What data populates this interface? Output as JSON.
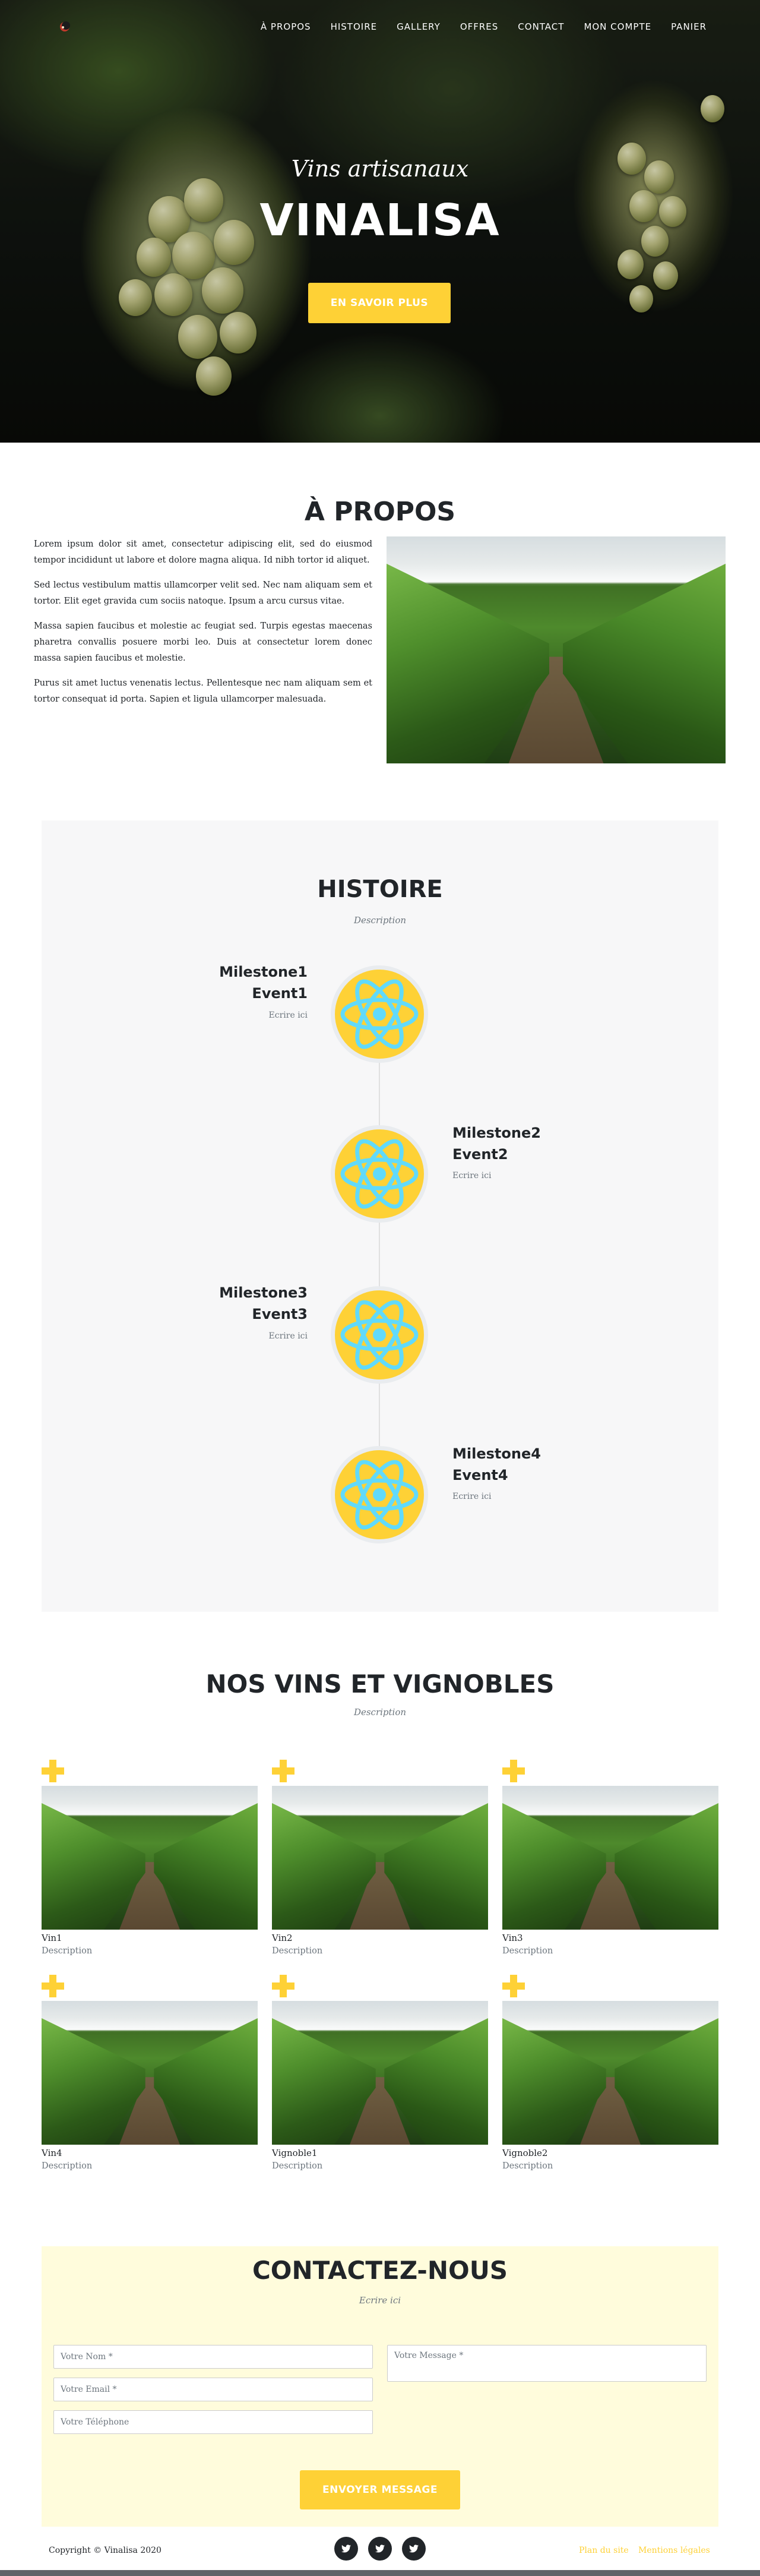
{
  "nav": {
    "items": [
      "À PROPOS",
      "HISTOIRE",
      "GALLERY",
      "OFFRES",
      "CONTACT",
      "MON COMPTE",
      "PANIER"
    ]
  },
  "hero": {
    "subtitle": "Vins artisanaux",
    "title": "VINALISA",
    "button": "EN SAVOIR PLUS"
  },
  "about": {
    "title": "À PROPOS",
    "paragraphs": [
      "Lorem ipsum dolor sit amet, consectetur adipiscing elit, sed do eiusmod tempor incididunt ut labore et dolore magna aliqua. Id nibh tortor id aliquet.",
      "Sed lectus vestibulum mattis ullamcorper velit sed. Nec nam aliquam sem et tortor. Elit eget gravida cum sociis natoque. Ipsum a arcu cursus vitae.",
      "Massa sapien faucibus et molestie ac feugiat sed. Turpis egestas maecenas pharetra convallis posuere morbi leo. Duis at consectetur lorem donec massa sapien faucibus et molestie.",
      "Purus sit amet luctus venenatis lectus. Pellentesque nec nam aliquam sem et tortor consequat id porta. Sapien et ligula ullamcorper malesuada."
    ]
  },
  "history": {
    "title": "HISTOIRE",
    "description": "Description",
    "milestones": [
      {
        "line1": "Milestone1",
        "line2": "Event1",
        "text": "Ecrire ici"
      },
      {
        "line1": "Milestone2",
        "line2": "Event2",
        "text": "Ecrire ici"
      },
      {
        "line1": "Milestone3",
        "line2": "Event3",
        "text": "Ecrire ici"
      },
      {
        "line1": "Milestone4",
        "line2": "Event4",
        "text": "Ecrire ici"
      }
    ]
  },
  "portfolio": {
    "title": "NOS VINS ET VIGNOBLES",
    "description": "Description",
    "items": [
      {
        "name": "Vin1",
        "desc": "Description"
      },
      {
        "name": "Vin2",
        "desc": "Description"
      },
      {
        "name": "Vin3",
        "desc": "Description"
      },
      {
        "name": "Vin4",
        "desc": "Description"
      },
      {
        "name": "Vignoble1",
        "desc": "Description"
      },
      {
        "name": "Vignoble2",
        "desc": "Description"
      }
    ]
  },
  "contact": {
    "title": "CONTACTEZ-NOUS",
    "description": "Ecrire ici",
    "name_placeholder": "Votre Nom *",
    "email_placeholder": "Votre Email *",
    "phone_placeholder": "Votre Téléphone",
    "message_placeholder": "Votre Message *",
    "button": "ENVOYER MESSAGE"
  },
  "footer": {
    "copyright": "Copyright © Vinalisa 2020",
    "links": [
      "Plan du site",
      "Mentions légales"
    ],
    "social_icons": [
      "twitter-icon",
      "twitter-icon",
      "twitter-icon"
    ]
  },
  "colors": {
    "accent": "#fed136",
    "dark": "#212529",
    "contact_bg": "#fffcdc",
    "history_bg": "#f7f7f8"
  }
}
